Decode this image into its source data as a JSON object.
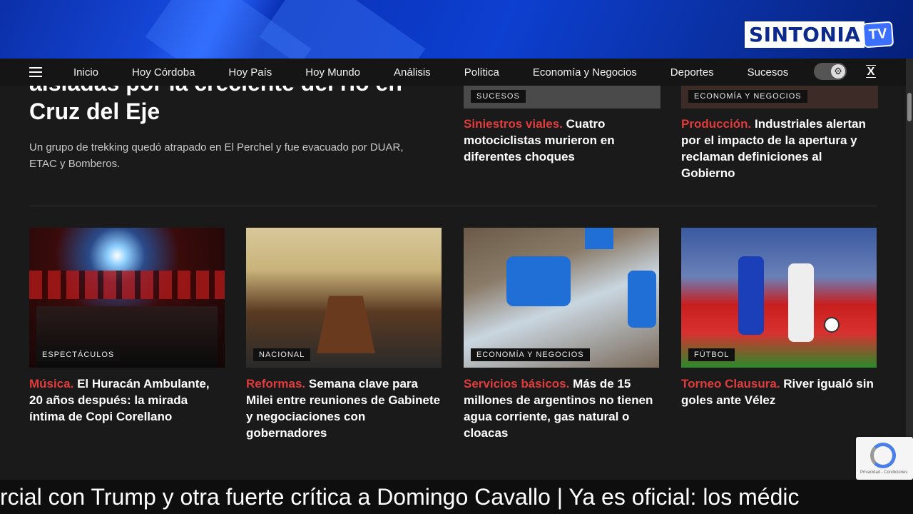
{
  "brand": {
    "logo_text": "SINTONIA",
    "logo_tv": "TV"
  },
  "nav": {
    "items": [
      "Inicio",
      "Hoy Córdoba",
      "Hoy País",
      "Hoy Mundo",
      "Análisis",
      "Política",
      "Economía y Negocios",
      "Deportes",
      "Sucesos"
    ]
  },
  "lead": {
    "title": "aisladas por la creciente del río en Cruz del Eje",
    "subtitle": "Un grupo de trekking quedó atrapado en El Perchel y fue evacuado por DUAR, ETAC y Bomberos."
  },
  "top_cards": [
    {
      "tag": "SUCESOS",
      "kicker": "Siniestros viales.",
      "headline": "Cuatro motociclistas murieron en diferentes choques"
    },
    {
      "tag": "ECONOMÍA Y NEGOCIOS",
      "kicker": "Producción.",
      "headline": "Industriales alertan por el impacto de la apertura y reclaman definiciones al Gobierno"
    }
  ],
  "cards": [
    {
      "tag": "ESPECTÁCULOS",
      "kicker": "Música.",
      "headline": "El Huracán Ambulante, 20 años después: la mirada íntima de Copi Corellano"
    },
    {
      "tag": "NACIONAL",
      "kicker": "Reformas.",
      "headline": "Semana clave para Milei entre reuniones de Gabinete y negociaciones con gobernadores"
    },
    {
      "tag": "ECONOMÍA Y NEGOCIOS",
      "kicker": "Servicios básicos.",
      "headline": "Más de 15 millones de argentinos no tienen agua corriente, gas natural o cloacas"
    },
    {
      "tag": "FÚTBOL",
      "kicker": "Torneo Clausura.",
      "headline": "River igualó sin goles ante Vélez"
    }
  ],
  "ticker": "rcial con Trump y otra fuerte crítica a Domingo Cavallo | Ya es oficial: los médic",
  "recaptcha": {
    "text": "Privacidad - Condiciones"
  },
  "colors": {
    "kicker": "#e23b3b",
    "background": "#1a1a1a",
    "nav": "#151515"
  }
}
